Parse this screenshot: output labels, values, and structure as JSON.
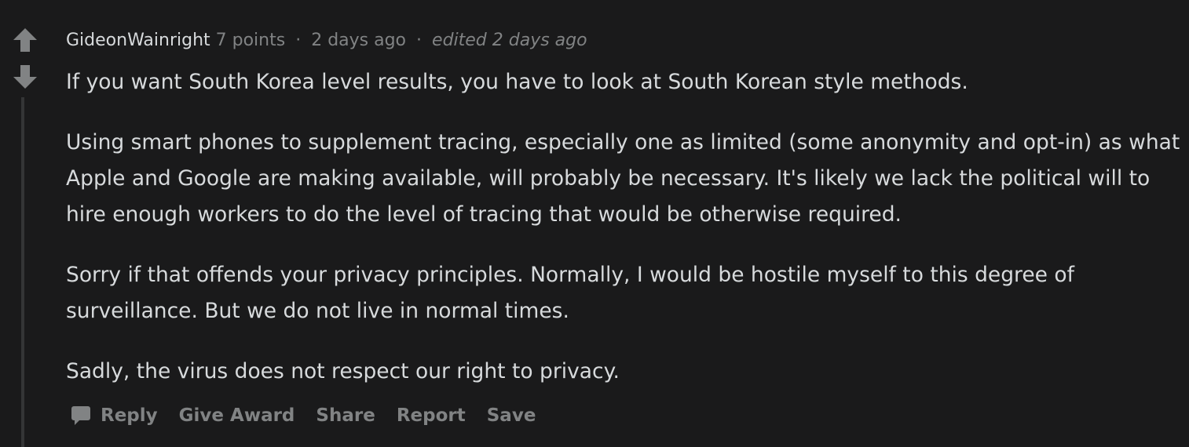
{
  "comment": {
    "author": "GideonWainright",
    "points": "7 points",
    "separator": "·",
    "posted": "2 days ago",
    "edited": "edited 2 days ago",
    "paragraphs": [
      "If you want South Korea level results, you have to look at South Korean style methods.",
      "Using smart phones to supplement tracing, especially one as limited (some anonymity and opt-in) as what Apple and Google are making available, will probably be necessary. It's likely we lack the political will to hire enough workers to do the level of tracing that would be otherwise required.",
      "Sorry if that offends your privacy principles. Normally, I would be hostile myself to this degree of surveillance. But we do not live in normal times.",
      "Sadly, the virus does not respect our right to privacy."
    ]
  },
  "actions": {
    "reply": "Reply",
    "give_award": "Give Award",
    "share": "Share",
    "report": "Report",
    "save": "Save"
  },
  "icons": {
    "upvote": "upvote-arrow-icon",
    "downvote": "downvote-arrow-icon",
    "reply": "speech-bubble-icon"
  },
  "colors": {
    "background": "#1a1a1b",
    "text": "#d7dadc",
    "muted": "#818384",
    "thread_line": "#343536"
  }
}
